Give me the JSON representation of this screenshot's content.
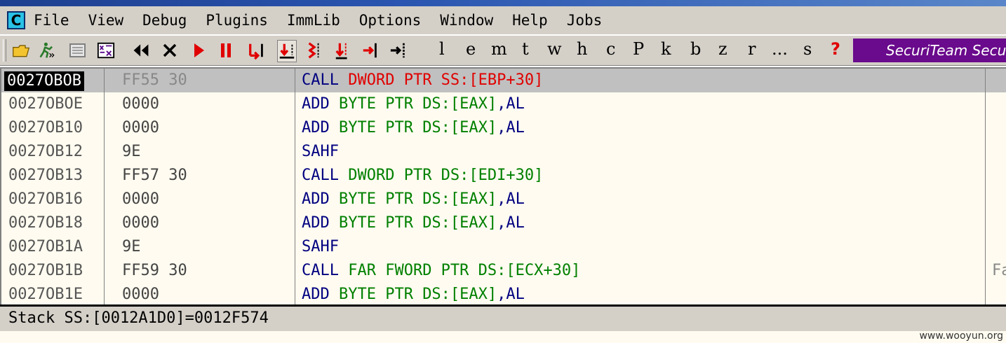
{
  "menu": {
    "app_icon_letter": "C",
    "items": [
      "File",
      "View",
      "Debug",
      "Plugins",
      "ImmLib",
      "Options",
      "Window",
      "Help",
      "Jobs"
    ]
  },
  "toolbar": {
    "icons": [
      "open-folder-icon",
      "run-man-icon",
      "window-icon",
      "grid-icon",
      "rewind-icon",
      "close-icon",
      "run-icon",
      "pause-icon",
      "step-into-icon",
      "step-over-icon",
      "trace-into-icon",
      "trace-over-icon",
      "execute-till-return-icon",
      "go-to-icon"
    ],
    "letters": [
      "l",
      "e",
      "m",
      "t",
      "w",
      "h",
      "c",
      "P",
      "k",
      "b",
      "z",
      "r",
      "...",
      "s",
      "?"
    ],
    "banner": "SecuriTeam Secu"
  },
  "disasm": {
    "rows": [
      {
        "addr": "0027OBOB",
        "hex": "FF55 30",
        "parts": [
          {
            "t": "CALL ",
            "c": "blue"
          },
          {
            "t": "DWORD PTR SS:[EBP+30]",
            "c": "red"
          }
        ],
        "selected": true,
        "comment": ""
      },
      {
        "addr": "0027OBOE",
        "hex": "0000",
        "parts": [
          {
            "t": "ADD ",
            "c": "blue"
          },
          {
            "t": "BYTE PTR DS:[EAX]",
            "c": "green"
          },
          {
            "t": ",AL",
            "c": "blue"
          }
        ],
        "comment": ""
      },
      {
        "addr": "0027OB10",
        "hex": "0000",
        "parts": [
          {
            "t": "ADD ",
            "c": "blue"
          },
          {
            "t": "BYTE PTR DS:[EAX]",
            "c": "green"
          },
          {
            "t": ",AL",
            "c": "blue"
          }
        ],
        "comment": ""
      },
      {
        "addr": "0027OB12",
        "hex": "9E",
        "parts": [
          {
            "t": "SAHF",
            "c": "blue"
          }
        ],
        "comment": ""
      },
      {
        "addr": "0027OB13",
        "hex": "FF57 30",
        "parts": [
          {
            "t": "CALL ",
            "c": "blue"
          },
          {
            "t": "DWORD PTR DS:[EDI+30]",
            "c": "green"
          }
        ],
        "comment": ""
      },
      {
        "addr": "0027OB16",
        "hex": "0000",
        "parts": [
          {
            "t": "ADD ",
            "c": "blue"
          },
          {
            "t": "BYTE PTR DS:[EAX]",
            "c": "green"
          },
          {
            "t": ",AL",
            "c": "blue"
          }
        ],
        "comment": ""
      },
      {
        "addr": "0027OB18",
        "hex": "0000",
        "parts": [
          {
            "t": "ADD ",
            "c": "blue"
          },
          {
            "t": "BYTE PTR DS:[EAX]",
            "c": "green"
          },
          {
            "t": ",AL",
            "c": "blue"
          }
        ],
        "comment": ""
      },
      {
        "addr": "0027OB1A",
        "hex": "9E",
        "parts": [
          {
            "t": "SAHF",
            "c": "blue"
          }
        ],
        "comment": ""
      },
      {
        "addr": "0027OB1B",
        "hex": "FF59 30",
        "parts": [
          {
            "t": "CALL ",
            "c": "blue"
          },
          {
            "t": "FAR FWORD PTR DS:[ECX+30]",
            "c": "green"
          }
        ],
        "comment": "Fa"
      },
      {
        "addr": "0027OB1E",
        "hex": "0000",
        "parts": [
          {
            "t": "ADD ",
            "c": "blue"
          },
          {
            "t": "BYTE PTR DS:[EAX]",
            "c": "green"
          },
          {
            "t": ",AL",
            "c": "blue"
          }
        ],
        "comment": ""
      }
    ]
  },
  "status": {
    "text": "Stack SS:[0012A1D0]=0012F574"
  },
  "watermark": "www.wooyun.org",
  "colors": {
    "instruction": "#000080",
    "operand": "#008000",
    "call_highlight": "#e00000",
    "banner": "#6a0a8c"
  }
}
